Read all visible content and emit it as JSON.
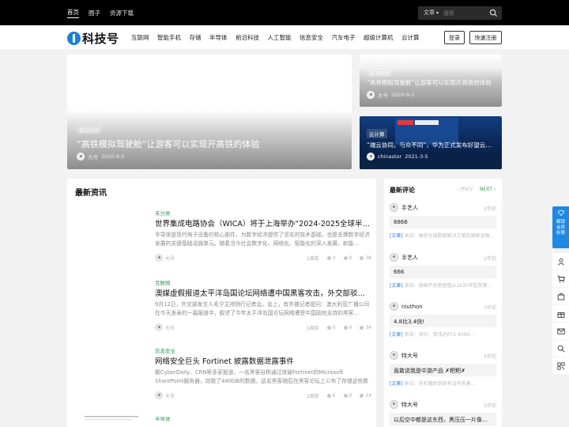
{
  "topbar": {
    "nav": [
      "首页",
      "圈子",
      "资源下载"
    ],
    "search_type": "文章",
    "search_placeholder": "搜索"
  },
  "header": {
    "logo_text": "科技号",
    "nav": [
      "互联网",
      "智能手机",
      "存储",
      "半导体",
      "前沿科技",
      "人工智能",
      "信息安全",
      "汽车电子",
      "超级计算机",
      "云计算"
    ],
    "login_label": "登录",
    "register_label": "快速注册"
  },
  "slides": {
    "big": {
      "tag": "前沿科技",
      "title": "“高铁模拟驾驶舱”让游客可以实现开高铁的体验",
      "author": "大号",
      "date": "2020-9-5"
    },
    "top_right": {
      "tag": "前沿科技",
      "title": "“高铁模拟驾驶舱”让游客可以实现开高铁的体验",
      "author": "大号",
      "date": "2020-9-5"
    },
    "bottom_right": {
      "tag": "云计算",
      "title": "“端云协同，与众不同”，华为正式发布好望云…",
      "author": "chinastor",
      "date": "2021-3-5"
    }
  },
  "latest": {
    "title": "最新资讯",
    "posts": [
      {
        "category": "未分类",
        "title": "世界集成电路协会（WICA）将于上海举办“2024-2025全球半导体…",
        "excerpt": "半导体是现代电子设备的核心部件，为数字经济提供了坚实的技术基础，也是支撑数字经济发展的关键基础设施单元。随着当今社会数字化、网络化、智能化的深入发展，新能…",
        "author": "大号",
        "time": "1周前",
        "likes": "0",
        "comments": "0",
        "views": "38"
      },
      {
        "category": "互联网",
        "title": "澳媒虚假报道太平洋岛国论坛网络遭中国黑客攻击，外交部驳斥！",
        "excerpt": "9月12日，外交部发言人毛宁主持例行记者会。会上，有外媒记者提问：澳大利亚广播公司在今天发表的一篇报道中，叙述了今年太平洋岛国论坛网络遭受中国政府支持的黑客…",
        "author": "大号",
        "time": "1周前",
        "likes": "0",
        "comments": "0",
        "views": "34"
      },
      {
        "category": "信息安全",
        "title": "网络安全巨头 Fortinet 披露数据泄露事件",
        "excerpt": "据CyberDaily、CRN等多家报道，一名黑客自称通过攻破Fortinet的Microsoft SharePoint服务器，窃取了440GB的数据。这名黑客随后在黑客论坛上公布了存储这些数据的S…",
        "author": "大号",
        "time": "2周前",
        "likes": "0",
        "comments": "0",
        "views": "14"
      },
      {
        "category": "半导体",
        "title": "",
        "excerpt": "",
        "author": "",
        "time": "",
        "likes": "",
        "comments": "",
        "views": ""
      }
    ]
  },
  "comments": {
    "title": "最新评论",
    "prev_label": "PREV",
    "next_label": "NEXT",
    "items": [
      {
        "user": "手艺人",
        "time": "2年前",
        "text": "8866",
        "source_label": "[文章]",
        "source": "来自：高质全域数据解决方案在国家金融…"
      },
      {
        "user": "手艺人",
        "time": "2年前",
        "text": "666",
        "source_label": "[文章]",
        "source": "来自：德国不同意欧盟从2035年起禁售…"
      },
      {
        "user": "niuthon",
        "time": "3年前",
        "text": "4.8比3.4快!",
        "source_label": "[文章]",
        "source": "来自：快讯：英伟达RTX 4090…"
      },
      {
        "user": "特大号",
        "time": "5年前",
        "text": "竟敢说我是中游产品 ✗粑粑✗",
        "source_label": "[文章]",
        "source": "来自：手机辐射到底有没有危害…"
      },
      {
        "user": "特大号",
        "time": "5年前",
        "text": "以后空中都是这东西，黑压压一片像蝗虫…",
        "source_label": "",
        "source": ""
      }
    ]
  },
  "sidebar": {
    "promo": [
      "解锁",
      "会员",
      "权限"
    ],
    "icons": [
      "user-icon",
      "cart-icon",
      "bag-icon",
      "gift-icon",
      "mail-icon",
      "search-icon",
      "qrcode-icon",
      "arrow-up-icon"
    ]
  },
  "colors": {
    "accent_green": "#2e9b57",
    "brand_blue": "#1a7fd6",
    "promo_blue": "#1e88e5",
    "link_blue": "#2d7bd8",
    "topbar": "#000000"
  }
}
